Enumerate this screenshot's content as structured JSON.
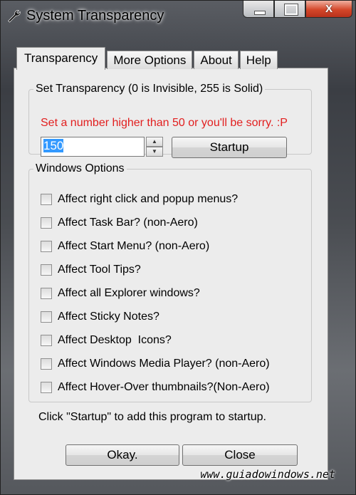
{
  "window": {
    "title": "System Transparency",
    "icon": "wrench-icon"
  },
  "caption_buttons": {
    "minimize": "minimize-icon",
    "maximize": "maximize-icon",
    "close_glyph": "X"
  },
  "tabs": [
    {
      "label": "Transparency",
      "active": true
    },
    {
      "label": "More Options",
      "active": false
    },
    {
      "label": "About",
      "active": false
    },
    {
      "label": "Help",
      "active": false
    }
  ],
  "transparency": {
    "legend": "Set Transparency (0 is Invisible, 255 is Solid)",
    "warning": "Set a number higher than 50 or you'll be sorry. :P",
    "value": "150",
    "startup_button": "Startup"
  },
  "windows_options": {
    "legend": "Windows Options",
    "items": [
      {
        "label": "Affect right click and popup menus?",
        "checked": false
      },
      {
        "label": "Affect Task Bar? (non-Aero)",
        "checked": false
      },
      {
        "label": "Affect Start Menu? (non-Aero)",
        "checked": false
      },
      {
        "label": "Affect Tool Tips?",
        "checked": false
      },
      {
        "label": "Affect all Explorer windows?",
        "checked": false
      },
      {
        "label": "Affect Sticky Notes?",
        "checked": false
      },
      {
        "label": "Affect Desktop  Icons?",
        "checked": false
      },
      {
        "label": "Affect Windows Media Player? (non-Aero)",
        "checked": false
      },
      {
        "label": "Affect Hover-Over thumbnails?(Non-Aero)",
        "checked": false
      }
    ]
  },
  "footer": {
    "hint": "Click \"Startup\" to add this program to startup.",
    "okay_button": "Okay.",
    "close_button": "Close"
  },
  "watermark": "www.guiadowindows.net",
  "colors": {
    "warning": "#e21f1f",
    "selection": "#3399ff",
    "close_button": "#d4472a"
  }
}
